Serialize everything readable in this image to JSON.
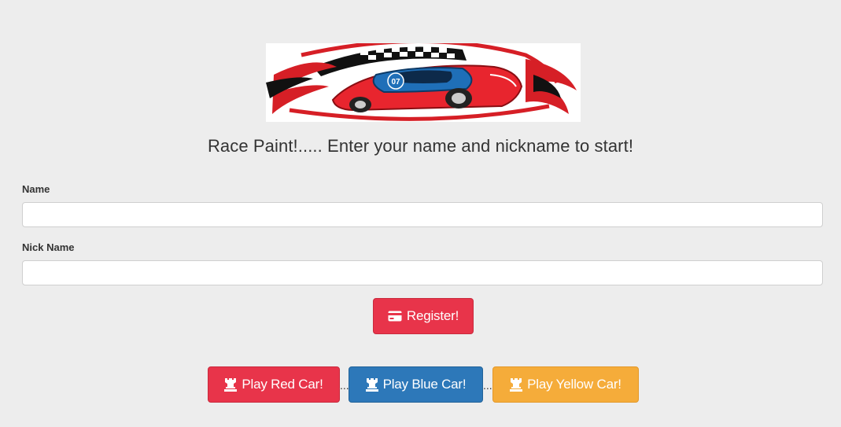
{
  "banner": {
    "logo_text": "07",
    "colors": {
      "red": "#e8252e",
      "blue": "#1f6fb8",
      "black": "#111111"
    }
  },
  "headline": "Race Paint!..... Enter your name and nickname to start!",
  "form": {
    "name_label": "Name",
    "name_value": "",
    "nick_label": "Nick Name",
    "nick_value": "",
    "register_label": "Register!",
    "register_icon": "credit-card-icon"
  },
  "play": {
    "separator": "...",
    "buttons": [
      {
        "label": "Play Red Car!",
        "icon": "rook-icon",
        "color": "#e8344a"
      },
      {
        "label": "Play Blue Car!",
        "icon": "rook-icon",
        "color": "#2d78b9"
      },
      {
        "label": "Play Yellow Car!",
        "icon": "rook-icon",
        "color": "#f5ac3a"
      }
    ]
  }
}
